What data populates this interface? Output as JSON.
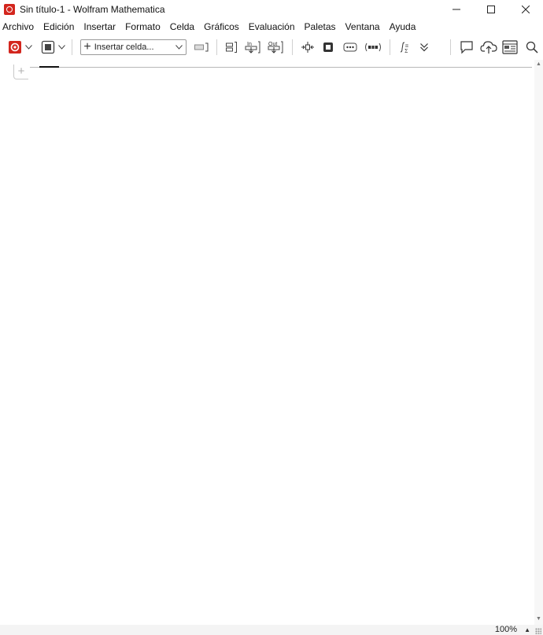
{
  "window": {
    "title": "Sin título-1 - Wolfram Mathematica",
    "controls": [
      "minimize",
      "maximize",
      "close"
    ]
  },
  "menu": {
    "items": [
      "Archivo",
      "Edición",
      "Insertar",
      "Formato",
      "Celda",
      "Gráficos",
      "Evaluación",
      "Paletas",
      "Ventana",
      "Ayuda"
    ]
  },
  "toolbar": {
    "insert_cell": {
      "plus": "+",
      "label": "Insertar celda..."
    },
    "icons": [
      "wolfram-logo-icon",
      "chevron-down-icon",
      "evaluate-icon",
      "chevron-down-icon",
      "cell-bracket-icon",
      "group-cells-icon",
      "in-arrow-icon",
      "out-arrow-icon",
      "split-icon",
      "selection-icon",
      "ellipsis-icon",
      "ellipsis-paren-icon",
      "math-assistant-icon",
      "double-chevron-icon",
      "comment-icon",
      "cloud-upload-icon",
      "notebook-icon",
      "search-icon"
    ],
    "in_label": "In",
    "out_label": "Out"
  },
  "notebook": {
    "cell_insert_plus": "+"
  },
  "status": {
    "zoom": "100%"
  },
  "colors": {
    "brand": "#d3261e"
  }
}
